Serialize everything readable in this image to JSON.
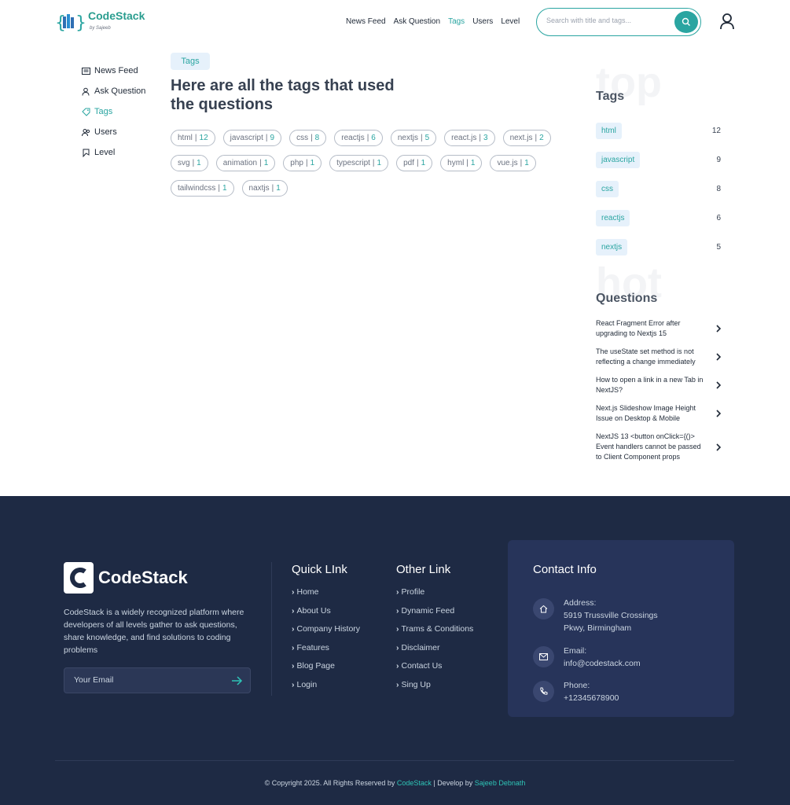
{
  "brand": {
    "name": "CodeStack",
    "byline": "by Sajeeb"
  },
  "topnav": [
    {
      "label": "News Feed",
      "active": false
    },
    {
      "label": "Ask Question",
      "active": false
    },
    {
      "label": "Tags",
      "active": true
    },
    {
      "label": "Users",
      "active": false
    },
    {
      "label": "Level",
      "active": false
    }
  ],
  "search": {
    "placeholder": "Search with title and tags..."
  },
  "leftnav": [
    {
      "label": "News Feed",
      "icon": "newspaper-icon",
      "active": false
    },
    {
      "label": "Ask Question",
      "icon": "user-question-icon",
      "active": false
    },
    {
      "label": "Tags",
      "icon": "tag-icon",
      "active": true
    },
    {
      "label": "Users",
      "icon": "users-icon",
      "active": false
    },
    {
      "label": "Level",
      "icon": "badge-icon",
      "active": false
    }
  ],
  "main": {
    "badge": "Tags",
    "title": "Here are all the tags that used the questions",
    "tags": [
      {
        "name": "html",
        "count": "12"
      },
      {
        "name": "javascript",
        "count": "9"
      },
      {
        "name": "css",
        "count": "8"
      },
      {
        "name": "reactjs",
        "count": "6"
      },
      {
        "name": "nextjs",
        "count": "5"
      },
      {
        "name": "react.js",
        "count": "3"
      },
      {
        "name": "next.js",
        "count": "2"
      },
      {
        "name": "svg",
        "count": "1"
      },
      {
        "name": "animation",
        "count": "1"
      },
      {
        "name": "php",
        "count": "1"
      },
      {
        "name": "typescript",
        "count": "1"
      },
      {
        "name": "pdf",
        "count": "1"
      },
      {
        "name": "hyml",
        "count": "1"
      },
      {
        "name": "vue.js",
        "count": "1"
      },
      {
        "name": "tailwindcss",
        "count": "1"
      },
      {
        "name": "naxtjs",
        "count": "1"
      }
    ]
  },
  "right": {
    "top_bg": "top",
    "top_title": "Tags",
    "top_tags": [
      {
        "name": "html",
        "count": "12"
      },
      {
        "name": "javascript",
        "count": "9"
      },
      {
        "name": "css",
        "count": "8"
      },
      {
        "name": "reactjs",
        "count": "6"
      },
      {
        "name": "nextjs",
        "count": "5"
      }
    ],
    "hot_bg": "hot",
    "hot_title": "Questions",
    "hot_questions": [
      "React Fragment Error after upgrading to Nextjs 15",
      "The useState set method is not reflecting a change immediately",
      "How to open a link in a new Tab in NextJS?",
      "Next.js Slideshow Image Height Issue on Desktop & Mobile",
      "NextJS 13 <button onClick={()> Event handlers cannot be passed to Client Component props"
    ]
  },
  "footer": {
    "brand": "CodeStack",
    "description": "CodeStack is a widely recognized platform where developers of all levels gather to ask questions, share knowledge, and find solutions to coding problems",
    "email_placeholder": "Your Email",
    "quick_title": "Quick LInk",
    "quick_links": [
      "Home",
      "About Us",
      "Company History",
      "Features",
      "Blog Page",
      "Login"
    ],
    "other_title": "Other Link",
    "other_links": [
      "Profile",
      "Dynamic Feed",
      "Trams & Conditions",
      "Disclaimer",
      "Contact Us",
      "Sing Up"
    ],
    "contact_title": "Contact Info",
    "address_label": "Address:",
    "address_line1": "5919 Trussville Crossings",
    "address_line2": "Pkwy, Birmingham",
    "email_label": "Email:",
    "email_value": "info@codestack.com",
    "phone_label": "Phone:",
    "phone_value": "+12345678900",
    "copyright_prefix": "© Copyright 2025. All Rights Reserved by",
    "copyright_brand": "CodeStack",
    "copyright_mid": "| Develop by",
    "copyright_author": "Sajeeb Debnath"
  },
  "colors": {
    "accent": "#2aa5a1",
    "footer_bg": "#1e2a44",
    "contact_bg": "#27345a"
  }
}
